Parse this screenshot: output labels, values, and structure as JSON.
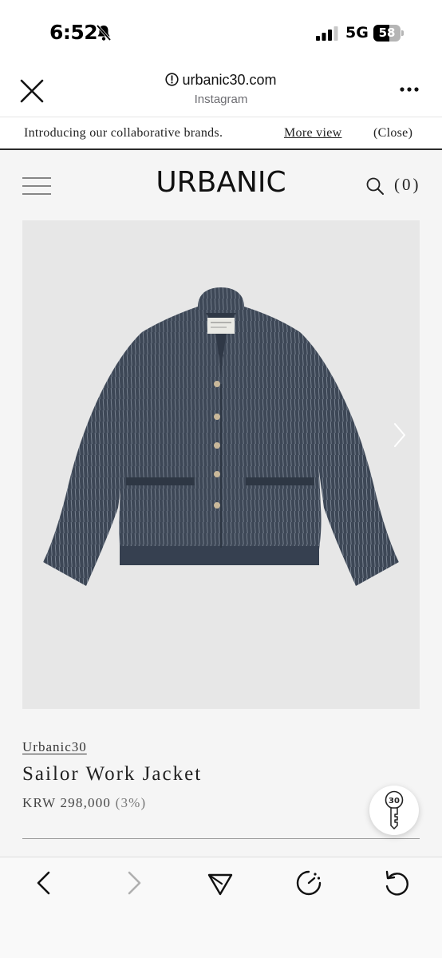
{
  "status_bar": {
    "time": "6:52",
    "network": "5G",
    "battery_text": "58",
    "battery_level": 0.58
  },
  "browser": {
    "url": "urbanic30.com",
    "source": "Instagram"
  },
  "banner": {
    "text": "Introducing our collaborative brands.",
    "more_label": "More view",
    "close_label": "(Close)"
  },
  "site": {
    "logo": "URBANIC",
    "cart_count": "(0)"
  },
  "product": {
    "brand": "Urbanic30",
    "name": "Sailor Work Jacket",
    "price": "KRW 298,000",
    "discount": "(3%)",
    "image_icon": "next-image-chevron"
  },
  "widget": {
    "key_label": "30"
  },
  "colors": {
    "site_background": "#f5f5f5",
    "image_background": "#e7e7e7",
    "jacket": "#3d4756",
    "text": "#222222"
  },
  "icons": [
    "bell-off-icon",
    "signal-icon",
    "info-icon",
    "close-icon",
    "more-icon",
    "hamburger-icon",
    "search-icon",
    "chevron-right-icon",
    "key-icon",
    "back-icon",
    "forward-icon",
    "share-icon",
    "loading-icon",
    "refresh-icon"
  ]
}
